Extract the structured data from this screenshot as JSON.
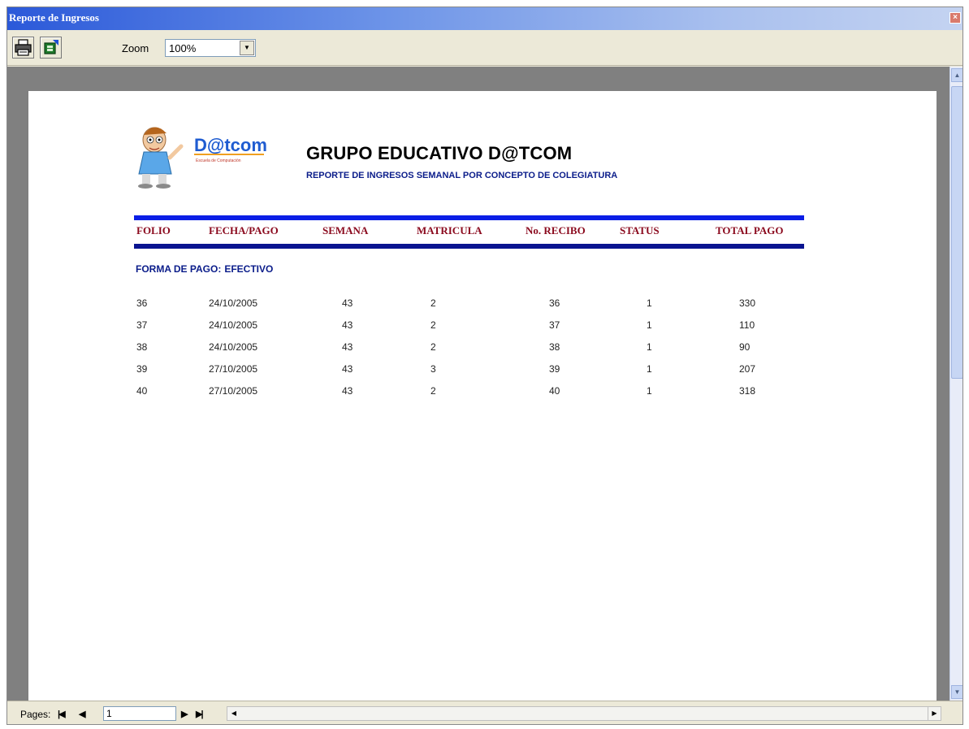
{
  "window": {
    "title": "Reporte de Ingresos",
    "close_label": "×"
  },
  "toolbar": {
    "print_icon": "printer-icon",
    "export_icon": "export-icon",
    "zoom_label": "Zoom",
    "zoom_value": "100%"
  },
  "report": {
    "logo_text": "D@tcom",
    "logo_tagline": "Escuela de Computación",
    "title": "GRUPO EDUCATIVO D@TCOM",
    "subtitle": "REPORTE DE INGRESOS SEMANAL POR CONCEPTO DE COLEGIATURA",
    "columns": [
      "FOLIO",
      "FECHA/PAGO",
      "SEMANA",
      "MATRICULA",
      "No. RECIBO",
      "STATUS",
      "TOTAL PAGO"
    ],
    "section_label": "FORMA DE PAGO:",
    "section_value": "EFECTIVO",
    "rows": [
      [
        "36",
        "24/10/2005",
        "43",
        "2",
        "36",
        "1",
        "330"
      ],
      [
        "37",
        "24/10/2005",
        "43",
        "2",
        "37",
        "1",
        "110"
      ],
      [
        "38",
        "24/10/2005",
        "43",
        "2",
        "38",
        "1",
        "90"
      ],
      [
        "39",
        "27/10/2005",
        "43",
        "3",
        "39",
        "1",
        "207"
      ],
      [
        "40",
        "27/10/2005",
        "43",
        "2",
        "40",
        "1",
        "318"
      ]
    ]
  },
  "statusbar": {
    "pages_label": "Pages:",
    "page_value": "1"
  },
  "colors": {
    "accent_blue": "#0a1ee6",
    "header_red": "#8b0a1e",
    "label_navy": "#0a1c8a"
  }
}
